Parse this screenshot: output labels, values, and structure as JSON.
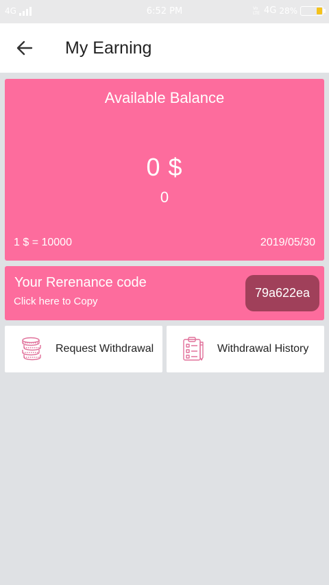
{
  "status_bar": {
    "network": "4G",
    "time": "6:52 PM",
    "volte": "Vo LTE",
    "network_right": "4G",
    "battery_percent": "28%",
    "battery_level": 0.28,
    "battery_color": "#f4c21b"
  },
  "header": {
    "back_icon": "arrow-left-icon",
    "title": "My Earning"
  },
  "balance": {
    "title": "Available Balance",
    "amount": "0 $",
    "points": "0",
    "rate": "1 $ = 10000",
    "date": "2019/05/30"
  },
  "referral": {
    "title": "Your Rerenance code",
    "hint": "Click here to Copy",
    "code": "79a622ea"
  },
  "actions": {
    "withdraw_icon": "coins-icon",
    "withdraw_label": "Request Withdrawal",
    "history_icon": "clipboard-icon",
    "history_label": "Withdrawal History"
  },
  "colors": {
    "accent": "#fd6c9d",
    "code_badge": "#a0405a",
    "background": "#dfe1e4"
  }
}
